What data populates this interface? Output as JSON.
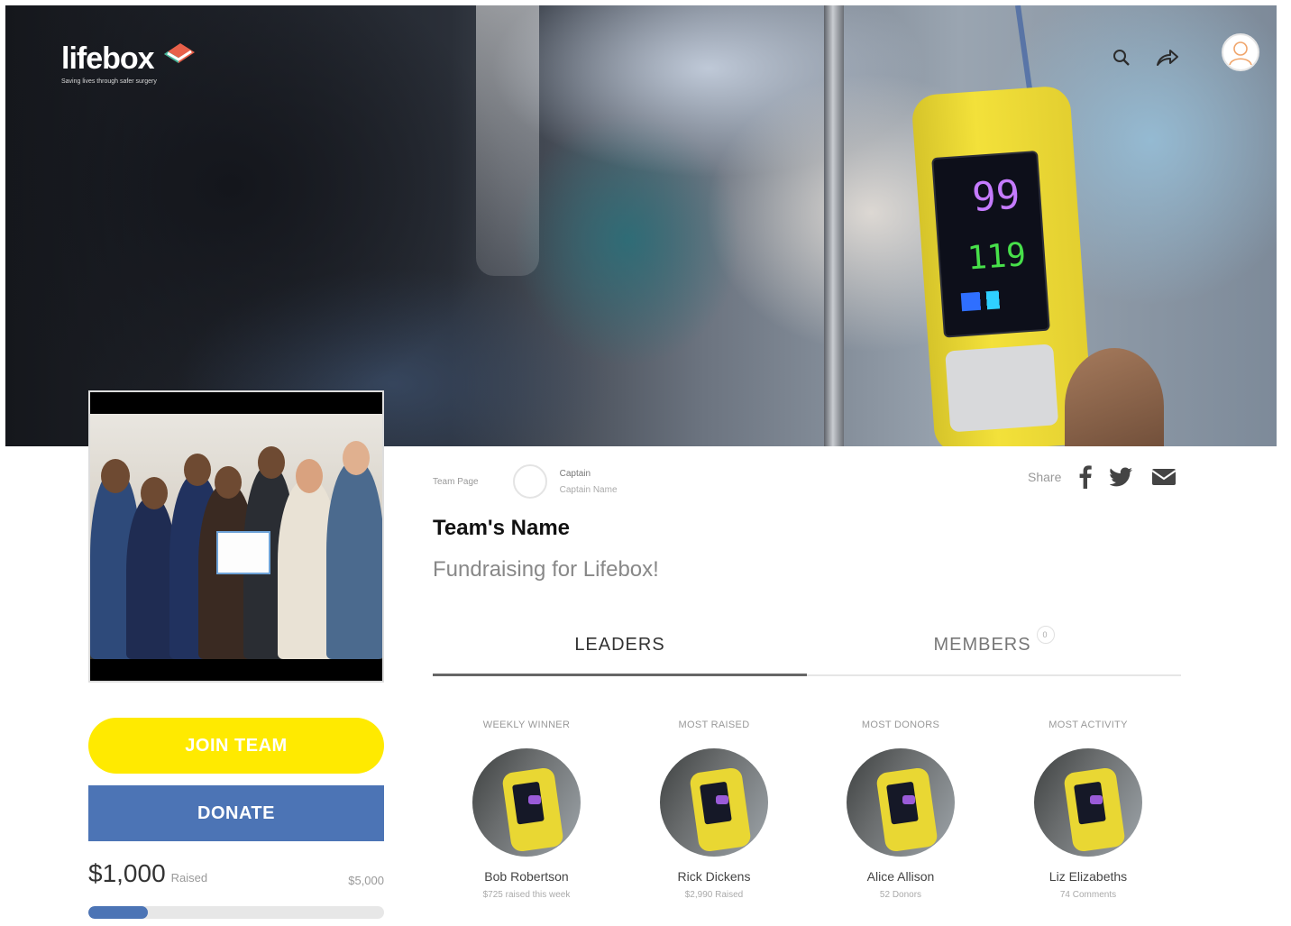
{
  "brand": {
    "name": "lifebox",
    "tagline": "Saving lives through safer surgery"
  },
  "hero": {
    "monitor_spo2": "99",
    "monitor_pulse": "119"
  },
  "header_icons": [
    "search-icon",
    "share-icon",
    "user-avatar-icon"
  ],
  "team": {
    "page_label": "Team Page",
    "captain_title": "Captain",
    "captain_name": "Captain Name",
    "name": "Team's Name",
    "subtitle": "Fundraising for Lifebox!"
  },
  "share": {
    "label": "Share",
    "icons": [
      "facebook-icon",
      "twitter-icon",
      "email-icon"
    ]
  },
  "actions": {
    "join_label": "JOIN TEAM",
    "donate_label": "DONATE"
  },
  "fundraising": {
    "raised": "$1,000",
    "raised_label": "Raised",
    "goal": "$5,000",
    "progress_fraction": 0.2
  },
  "tabs": [
    {
      "label": "LEADERS",
      "active": true
    },
    {
      "label": "MEMBERS",
      "count": "0",
      "active": false
    }
  ],
  "leaders": [
    {
      "category": "WEEKLY WINNER",
      "name": "Bob Robertson",
      "stat": "$725 raised this week"
    },
    {
      "category": "MOST RAISED",
      "name": "Rick Dickens",
      "stat": "$2,990 Raised"
    },
    {
      "category": "MOST DONORS",
      "name": "Alice Allison",
      "stat": "52 Donors"
    },
    {
      "category": "MOST ACTIVITY",
      "name": "Liz Elizabeths",
      "stat": "74 Comments"
    }
  ],
  "colors": {
    "join": "#ffea00",
    "donate": "#4c74b5",
    "progress": "#4c74b5"
  }
}
